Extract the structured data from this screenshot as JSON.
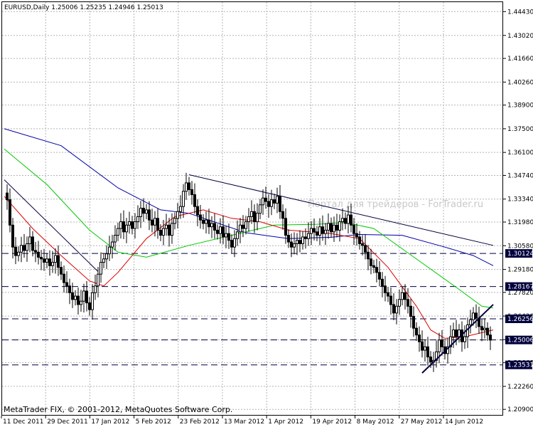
{
  "chart_data": {
    "type": "candlestick",
    "symbol_header": "EURUSD,Daily  1.25006 1.25235 1.24946 1.25013",
    "watermark": "Портал для трейдеров - ForTrader.ru",
    "footer": "MetaTrader FIX, © 2001-2012, MetaQuotes Software Corp.",
    "ylim": [
      1.2053,
      1.4499
    ],
    "grid": true,
    "y_ticks": [
      "1.44430",
      "1.43020",
      "1.41660",
      "1.40260",
      "1.38900",
      "1.37500",
      "1.36100",
      "1.34740",
      "1.33340",
      "1.31980",
      "1.30580",
      "1.29180",
      "1.27820",
      "1.26420",
      "1.25020",
      "1.23660",
      "1.22260",
      "1.20900"
    ],
    "x_ticks": [
      "11 Dec 2011",
      "29 Dec 2011",
      "17 Jan 2012",
      "5 Feb 2012",
      "23 Feb 2012",
      "13 Mar 2012",
      "1 Apr 2012",
      "19 Apr 2012",
      "8 May 2012",
      "27 May 2012",
      "14 Jun 2012"
    ],
    "price_labels": [
      {
        "text": "1.30124",
        "value": 1.30124
      },
      {
        "text": "1.28167",
        "value": 1.28167
      },
      {
        "text": "1.26256",
        "value": 1.26256
      },
      {
        "text": "1.25006",
        "value": 1.25006
      },
      {
        "text": "1.23531",
        "value": 1.23531
      }
    ],
    "horizontal_levels": [
      1.30124,
      1.28167,
      1.26256,
      1.25006,
      1.23531
    ],
    "trendlines": [
      {
        "from": [
          0,
          1.3448
        ],
        "to": [
          33,
          1.2905
        ],
        "width": 1
      },
      {
        "from": [
          65,
          1.3478
        ],
        "to": [
          172,
          1.306
        ],
        "width": 1
      },
      {
        "from": [
          147,
          1.2305
        ],
        "to": [
          172,
          1.271
        ],
        "width": 2
      }
    ],
    "close_path": [
      [
        0,
        1.337
      ],
      [
        1,
        1.333
      ],
      [
        2,
        1.318
      ],
      [
        3,
        1.305
      ],
      [
        4,
        1.3
      ],
      [
        5,
        1.302
      ],
      [
        6,
        1.306
      ],
      [
        7,
        1.303
      ],
      [
        8,
        1.307
      ],
      [
        9,
        1.311
      ],
      [
        10,
        1.303
      ],
      [
        11,
        1.302
      ],
      [
        12,
        1.299
      ],
      [
        13,
        1.298
      ],
      [
        14,
        1.296
      ],
      [
        15,
        1.298
      ],
      [
        16,
        1.294
      ],
      [
        17,
        1.296
      ],
      [
        18,
        1.3
      ],
      [
        19,
        1.293
      ],
      [
        20,
        1.289
      ],
      [
        21,
        1.284
      ],
      [
        22,
        1.282
      ],
      [
        23,
        1.278
      ],
      [
        24,
        1.274
      ],
      [
        25,
        1.276
      ],
      [
        26,
        1.271
      ],
      [
        27,
        1.273
      ],
      [
        28,
        1.279
      ],
      [
        29,
        1.272
      ],
      [
        30,
        1.268
      ],
      [
        31,
        1.278
      ],
      [
        32,
        1.282
      ],
      [
        33,
        1.289
      ],
      [
        34,
        1.296
      ],
      [
        35,
        1.298
      ],
      [
        36,
        1.301
      ],
      [
        37,
        1.305
      ],
      [
        38,
        1.308
      ],
      [
        39,
        1.312
      ],
      [
        40,
        1.316
      ],
      [
        41,
        1.32
      ],
      [
        42,
        1.314
      ],
      [
        43,
        1.318
      ],
      [
        44,
        1.32
      ],
      [
        45,
        1.316
      ],
      [
        46,
        1.32
      ],
      [
        47,
        1.323
      ],
      [
        48,
        1.328
      ],
      [
        49,
        1.325
      ],
      [
        50,
        1.327
      ],
      [
        51,
        1.321
      ],
      [
        52,
        1.318
      ],
      [
        53,
        1.322
      ],
      [
        54,
        1.315
      ],
      [
        55,
        1.312
      ],
      [
        56,
        1.316
      ],
      [
        57,
        1.318
      ],
      [
        58,
        1.312
      ],
      [
        59,
        1.319
      ],
      [
        60,
        1.322
      ],
      [
        61,
        1.326
      ],
      [
        62,
        1.329
      ],
      [
        63,
        1.338
      ],
      [
        64,
        1.343
      ],
      [
        65,
        1.339
      ],
      [
        66,
        1.336
      ],
      [
        67,
        1.329
      ],
      [
        68,
        1.324
      ],
      [
        69,
        1.321
      ],
      [
        70,
        1.319
      ],
      [
        71,
        1.321
      ],
      [
        72,
        1.317
      ],
      [
        73,
        1.319
      ],
      [
        74,
        1.315
      ],
      [
        75,
        1.313
      ],
      [
        76,
        1.317
      ],
      [
        77,
        1.311
      ],
      [
        78,
        1.313
      ],
      [
        79,
        1.309
      ],
      [
        80,
        1.305
      ],
      [
        81,
        1.31
      ],
      [
        82,
        1.314
      ],
      [
        83,
        1.318
      ],
      [
        84,
        1.316
      ],
      [
        85,
        1.32
      ],
      [
        86,
        1.323
      ],
      [
        87,
        1.326
      ],
      [
        88,
        1.32
      ],
      [
        89,
        1.325
      ],
      [
        90,
        1.33
      ],
      [
        91,
        1.334
      ],
      [
        92,
        1.332
      ],
      [
        93,
        1.329
      ],
      [
        94,
        1.333
      ],
      [
        95,
        1.331
      ],
      [
        96,
        1.335
      ],
      [
        97,
        1.326
      ],
      [
        98,
        1.322
      ],
      [
        99,
        1.312
      ],
      [
        100,
        1.308
      ],
      [
        101,
        1.305
      ],
      [
        102,
        1.307
      ],
      [
        103,
        1.309
      ],
      [
        104,
        1.307
      ],
      [
        105,
        1.311
      ],
      [
        106,
        1.31
      ],
      [
        107,
        1.313
      ],
      [
        108,
        1.316
      ],
      [
        109,
        1.314
      ],
      [
        110,
        1.312
      ],
      [
        111,
        1.317
      ],
      [
        112,
        1.313
      ],
      [
        113,
        1.315
      ],
      [
        114,
        1.319
      ],
      [
        115,
        1.314
      ],
      [
        116,
        1.318
      ],
      [
        117,
        1.315
      ],
      [
        118,
        1.32
      ],
      [
        119,
        1.322
      ],
      [
        120,
        1.319
      ],
      [
        121,
        1.324
      ],
      [
        122,
        1.318
      ],
      [
        123,
        1.313
      ],
      [
        124,
        1.311
      ],
      [
        125,
        1.307
      ],
      [
        126,
        1.306
      ],
      [
        127,
        1.302
      ],
      [
        128,
        1.298
      ],
      [
        129,
        1.294
      ],
      [
        130,
        1.293
      ],
      [
        131,
        1.29
      ],
      [
        132,
        1.286
      ],
      [
        133,
        1.282
      ],
      [
        134,
        1.278
      ],
      [
        135,
        1.276
      ],
      [
        136,
        1.271
      ],
      [
        137,
        1.266
      ],
      [
        138,
        1.27
      ],
      [
        139,
        1.274
      ],
      [
        140,
        1.278
      ],
      [
        141,
        1.274
      ],
      [
        142,
        1.27
      ],
      [
        143,
        1.264
      ],
      [
        144,
        1.257
      ],
      [
        145,
        1.253
      ],
      [
        146,
        1.249
      ],
      [
        147,
        1.244
      ],
      [
        148,
        1.246
      ],
      [
        149,
        1.24
      ],
      [
        150,
        1.237
      ],
      [
        151,
        1.238
      ],
      [
        152,
        1.243
      ],
      [
        153,
        1.25
      ],
      [
        154,
        1.246
      ],
      [
        155,
        1.242
      ],
      [
        156,
        1.246
      ],
      [
        157,
        1.252
      ],
      [
        158,
        1.256
      ],
      [
        159,
        1.252
      ],
      [
        160,
        1.256
      ],
      [
        161,
        1.249
      ],
      [
        162,
        1.252
      ],
      [
        163,
        1.259
      ],
      [
        164,
        1.262
      ],
      [
        165,
        1.266
      ],
      [
        166,
        1.263
      ],
      [
        167,
        1.258
      ],
      [
        168,
        1.256
      ],
      [
        169,
        1.257
      ],
      [
        170,
        1.253
      ],
      [
        171,
        1.25
      ]
    ],
    "ma_series": [
      {
        "color": "#0000a8",
        "points": [
          [
            0,
            1.375
          ],
          [
            20,
            1.365
          ],
          [
            40,
            1.34
          ],
          [
            55,
            1.327
          ],
          [
            65,
            1.325
          ],
          [
            85,
            1.3135
          ],
          [
            100,
            1.31
          ],
          [
            115,
            1.3108
          ],
          [
            125,
            1.3125
          ],
          [
            140,
            1.312
          ],
          [
            155,
            1.305
          ],
          [
            165,
            1.3
          ],
          [
            172,
            1.294
          ]
        ]
      },
      {
        "color": "#00c800",
        "points": [
          [
            0,
            1.363
          ],
          [
            15,
            1.342
          ],
          [
            30,
            1.315
          ],
          [
            40,
            1.302
          ],
          [
            50,
            1.299
          ],
          [
            65,
            1.306
          ],
          [
            80,
            1.312
          ],
          [
            95,
            1.318
          ],
          [
            110,
            1.3185
          ],
          [
            120,
            1.3195
          ],
          [
            130,
            1.316
          ],
          [
            140,
            1.304
          ],
          [
            150,
            1.292
          ],
          [
            160,
            1.28
          ],
          [
            168,
            1.27
          ],
          [
            172,
            1.269
          ]
        ]
      },
      {
        "color": "#dc0000",
        "points": [
          [
            0,
            1.335
          ],
          [
            10,
            1.316
          ],
          [
            20,
            1.3
          ],
          [
            30,
            1.285
          ],
          [
            35,
            1.282
          ],
          [
            40,
            1.29
          ],
          [
            50,
            1.31
          ],
          [
            60,
            1.323
          ],
          [
            70,
            1.327
          ],
          [
            80,
            1.322
          ],
          [
            90,
            1.32
          ],
          [
            100,
            1.315
          ],
          [
            115,
            1.313
          ],
          [
            125,
            1.31
          ],
          [
            135,
            1.293
          ],
          [
            145,
            1.27
          ],
          [
            150,
            1.256
          ],
          [
            155,
            1.251
          ],
          [
            162,
            1.252
          ],
          [
            172,
            1.256
          ]
        ]
      }
    ]
  }
}
